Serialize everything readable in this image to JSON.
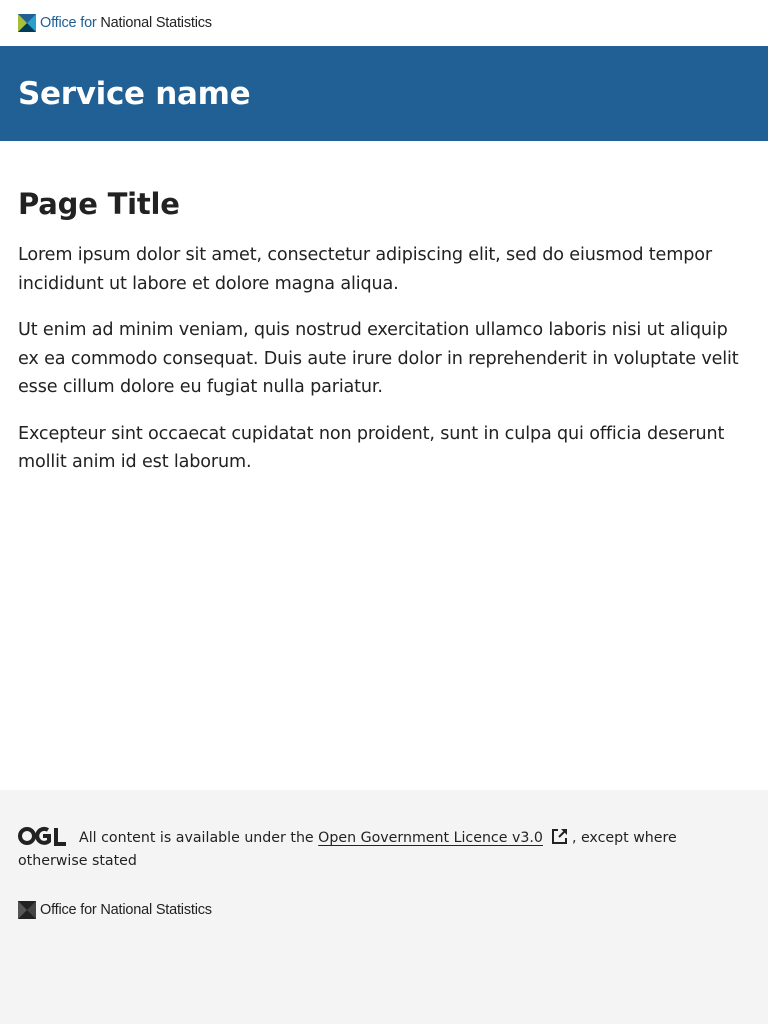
{
  "header": {
    "logo_text_pre": "Office for ",
    "logo_text_post": "National Statistics"
  },
  "service": {
    "name": "Service name"
  },
  "main": {
    "title": "Page Title",
    "paragraphs": [
      "Lorem ipsum dolor sit amet, consectetur adipiscing elit, sed do eiusmod tempor incididunt ut labore et dolore magna aliqua.",
      "Ut enim ad minim veniam, quis nostrud exercitation ullamco laboris nisi ut aliquip ex ea commodo consequat. Duis aute irure dolor in reprehenderit in voluptate velit esse cillum dolore eu fugiat nulla pariatur.",
      "Excepteur sint occaecat cupidatat non proident, sunt in culpa qui officia deserunt mollit anim id est laborum."
    ]
  },
  "footer": {
    "licence_prefix": "All content is available under the ",
    "licence_link": "Open Government Licence v3.0",
    "licence_suffix": ", except where otherwise stated",
    "logo_text_pre": "Office for ",
    "logo_text_post": "National Statistics"
  },
  "colors": {
    "brand_blue": "#206095",
    "footer_bg": "#f4f4f4",
    "text": "#222222"
  },
  "icons": {
    "external_link": "external-link-icon",
    "ogl": "ogl-logo-icon"
  }
}
